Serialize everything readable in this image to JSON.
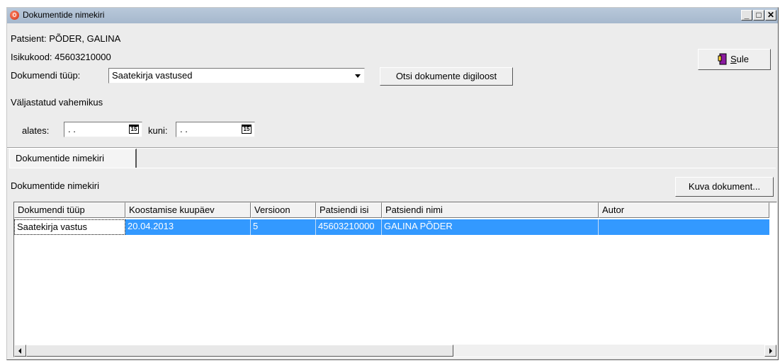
{
  "window": {
    "title": "Dokumentide nimekiri",
    "btn_min": "_",
    "btn_max": "□",
    "btn_close": "✕"
  },
  "patient": {
    "name_label": "Patsient: PÕDER, GALINA",
    "code_label": "Isikukood: 45603210000"
  },
  "doctype": {
    "label": "Dokumendi tüüp:",
    "value": "Saatekirja vastused"
  },
  "search_button": "Otsi dokumente digiloost",
  "close_button": {
    "mnemonic": "S",
    "rest": "ule"
  },
  "range": {
    "label": "Väljastatud vahemikus",
    "from_label": "alates:",
    "from_value": ". .",
    "to_label": "kuni:",
    "to_value": ". .",
    "cal_glyph": "15"
  },
  "tab_label": "Dokumentide nimekiri",
  "list_label": "Dokumentide nimekiri",
  "show_button": "Kuva dokument...",
  "grid": {
    "columns": [
      "Dokumendi tüüp",
      "Koostamise kuupäev",
      "Versioon",
      "Patsiendi isi",
      "Patsiendi nimi",
      "Autor"
    ],
    "rows": [
      [
        "Saatekirja vastus",
        "20.04.2013",
        "5",
        "45603210000",
        "GALINA PÕDER",
        ""
      ]
    ]
  },
  "colors": {
    "selection": "#3399ff",
    "titlebar": "#b0c2d6"
  }
}
